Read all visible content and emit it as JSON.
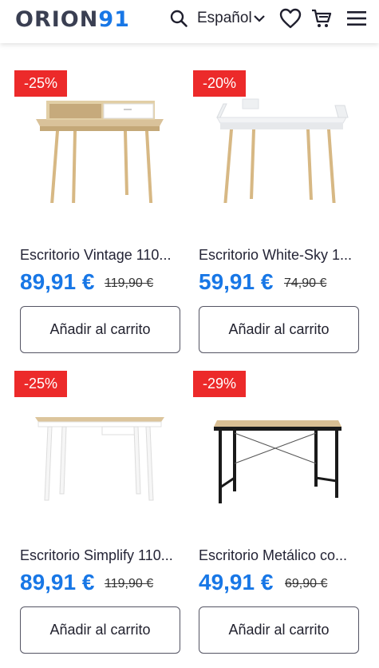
{
  "header": {
    "logo_text": "ORION",
    "logo_number": "91",
    "language": "Español"
  },
  "icons": {
    "search": "search-icon",
    "language_chevron": "chevron-down-icon",
    "favorites": "heart-icon",
    "cart": "cart-icon",
    "menu": "hamburger-menu-icon"
  },
  "colors": {
    "accent": "#1877e6",
    "badge": "#ec2a2a"
  },
  "products": [
    {
      "discount": "-25%",
      "title": "Escritorio Vintage 110...",
      "price": "89,91 €",
      "old_price": "119,90 €",
      "button": "Añadir al carrito"
    },
    {
      "discount": "-20%",
      "title": "Escritorio White-Sky 1...",
      "price": "59,91 €",
      "old_price": "74,90 €",
      "button": "Añadir al carrito"
    },
    {
      "discount": "-25%",
      "title": "Escritorio Simplify 110...",
      "price": "89,91 €",
      "old_price": "119,90 €",
      "button": "Añadir al carrito"
    },
    {
      "discount": "-29%",
      "title": "Escritorio Metálico co...",
      "price": "49,91 €",
      "old_price": "69,90 €",
      "button": "Añadir al carrito"
    }
  ]
}
